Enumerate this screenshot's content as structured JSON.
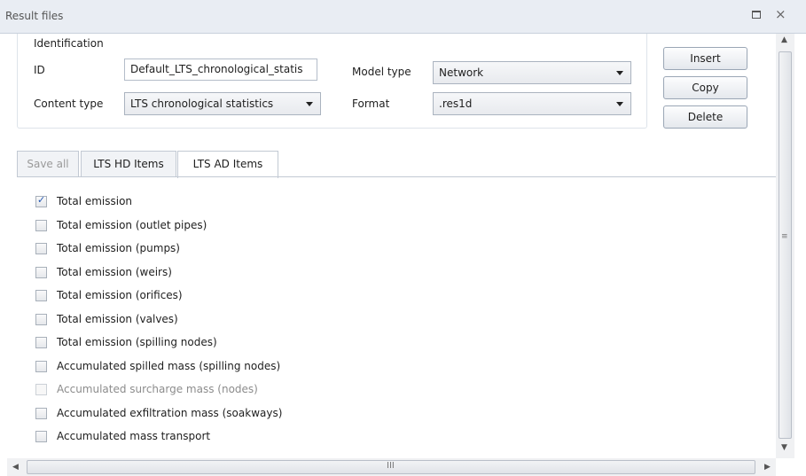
{
  "window": {
    "title": "Result files",
    "max_icon": "maximize-icon",
    "close_glyph": "×"
  },
  "identification": {
    "group_title": "Identification",
    "id_label": "ID",
    "id_value": "Default_LTS_chronological_statis",
    "content_type_label": "Content type",
    "content_type_value": "LTS chronological statistics",
    "model_type_label": "Model type",
    "model_type_value": "Network",
    "format_label": "Format",
    "format_value": ".res1d"
  },
  "buttons": {
    "insert": "Insert",
    "copy": "Copy",
    "delete": "Delete"
  },
  "tabs": [
    {
      "label": "Save all",
      "state": "disabled"
    },
    {
      "label": "LTS HD Items",
      "state": "normal"
    },
    {
      "label": "LTS AD Items",
      "state": "active"
    }
  ],
  "items": [
    {
      "label": "Total emission",
      "checked": true,
      "enabled": true
    },
    {
      "label": "Total emission (outlet pipes)",
      "checked": false,
      "enabled": true
    },
    {
      "label": "Total emission (pumps)",
      "checked": false,
      "enabled": true
    },
    {
      "label": "Total emission (weirs)",
      "checked": false,
      "enabled": true
    },
    {
      "label": "Total emission (orifices)",
      "checked": false,
      "enabled": true
    },
    {
      "label": "Total emission (valves)",
      "checked": false,
      "enabled": true
    },
    {
      "label": "Total emission (spilling nodes)",
      "checked": false,
      "enabled": true
    },
    {
      "label": "Accumulated spilled mass (spilling nodes)",
      "checked": false,
      "enabled": true
    },
    {
      "label": "Accumulated surcharge mass (nodes)",
      "checked": false,
      "enabled": false
    },
    {
      "label": "Accumulated exfiltration mass (soakways)",
      "checked": false,
      "enabled": true
    },
    {
      "label": "Accumulated mass transport",
      "checked": false,
      "enabled": true
    }
  ],
  "scrollbar": {
    "up_glyph": "▲",
    "down_glyph": "▼",
    "left_glyph": "◀",
    "right_glyph": "▶",
    "grip_v": "≡",
    "grip_h": "III"
  }
}
